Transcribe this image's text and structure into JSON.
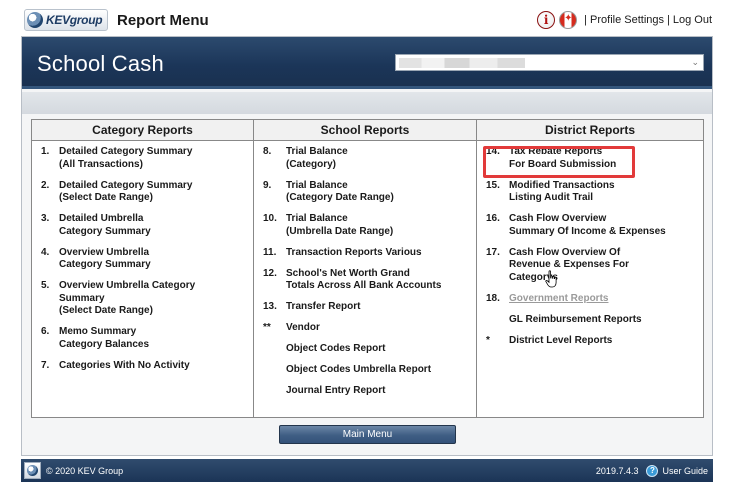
{
  "topbar": {
    "logo_text": "KEVgroup",
    "title": "Report Menu",
    "info_glyph": "i",
    "profile_link": "Profile Settings",
    "logout_link": "Log Out",
    "separator": "|"
  },
  "header": {
    "title": "School Cash",
    "school_select_value": "",
    "select_arrow": "⌵"
  },
  "columns": {
    "category": {
      "title": "Category Reports",
      "items": [
        {
          "num": "1.",
          "label": "Detailed Category Summary\n(All Transactions)"
        },
        {
          "num": "2.",
          "label": "Detailed Category Summary\n(Select Date Range)"
        },
        {
          "num": "3.",
          "label": "Detailed Umbrella\nCategory Summary"
        },
        {
          "num": "4.",
          "label": "Overview Umbrella\nCategory Summary"
        },
        {
          "num": "5.",
          "label": "Overview Umbrella Category\nSummary\n(Select Date Range)"
        },
        {
          "num": "6.",
          "label": "Memo Summary\nCategory Balances"
        },
        {
          "num": "7.",
          "label": "Categories With No Activity"
        }
      ]
    },
    "school": {
      "title": "School Reports",
      "items": [
        {
          "num": "8.",
          "label": "Trial Balance\n(Category)"
        },
        {
          "num": "9.",
          "label": "Trial Balance\n(Category Date Range)"
        },
        {
          "num": "10.",
          "label": "Trial Balance\n(Umbrella Date Range)"
        },
        {
          "num": "11.",
          "label": "Transaction Reports Various"
        },
        {
          "num": "12.",
          "label": "School's Net Worth Grand\nTotals Across All Bank Accounts"
        },
        {
          "num": "13.",
          "label": "Transfer Report"
        },
        {
          "num": "**",
          "label": "Vendor"
        },
        {
          "num": "",
          "label": "Object Codes Report"
        },
        {
          "num": "",
          "label": "Object Codes Umbrella Report"
        },
        {
          "num": "",
          "label": "Journal Entry Report"
        }
      ]
    },
    "district": {
      "title": "District Reports",
      "items": [
        {
          "num": "14.",
          "label": "Tax Rebate Reports\nFor Board Submission"
        },
        {
          "num": "15.",
          "label": "Modified Transactions\nListing Audit Trail"
        },
        {
          "num": "16.",
          "label": "Cash Flow Overview\nSummary Of Income & Expenses"
        },
        {
          "num": "17.",
          "label": "Cash Flow Overview Of\nRevenue & Expenses For\nCategorys"
        },
        {
          "num": "18.",
          "label": "Government Reports"
        },
        {
          "num": "",
          "label": "GL Reimbursement Reports"
        },
        {
          "num": "*",
          "label": "District Level Reports"
        }
      ]
    }
  },
  "main_menu_button": "Main Menu",
  "footer": {
    "copyright": "© 2020 KEV Group",
    "version": "2019.7.4.3",
    "help_glyph": "?",
    "user_guide": "User Guide"
  },
  "colors": {
    "header_bg": "#1b3558",
    "highlight": "#e23a3a",
    "link_gray": "#9a9a9a"
  }
}
